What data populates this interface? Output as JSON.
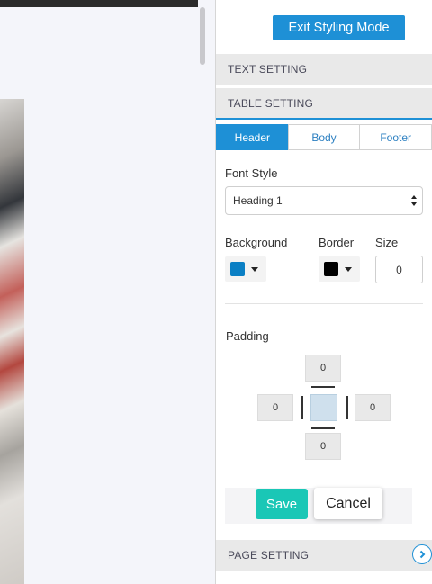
{
  "header": {
    "exit_label": "Exit Styling Mode"
  },
  "sections": {
    "text_setting": "TEXT SETTING",
    "table_setting": "TABLE SETTING",
    "page_setting": "PAGE SETTING"
  },
  "tabs": [
    {
      "label": "Header",
      "active": true
    },
    {
      "label": "Body",
      "active": false
    },
    {
      "label": "Footer",
      "active": false
    }
  ],
  "font_style": {
    "label": "Font Style",
    "value": "Heading 1"
  },
  "background": {
    "label": "Background",
    "color": "#0a7fc4"
  },
  "border": {
    "label": "Border",
    "color": "#000000"
  },
  "size": {
    "label": "Size",
    "value": "0"
  },
  "padding": {
    "label": "Padding",
    "top": "0",
    "left": "0",
    "right": "0",
    "bottom": "0"
  },
  "actions": {
    "save_label": "Save",
    "cancel_label": "Cancel"
  },
  "colors": {
    "accent": "#1e90d6",
    "save": "#1ac7b6"
  }
}
